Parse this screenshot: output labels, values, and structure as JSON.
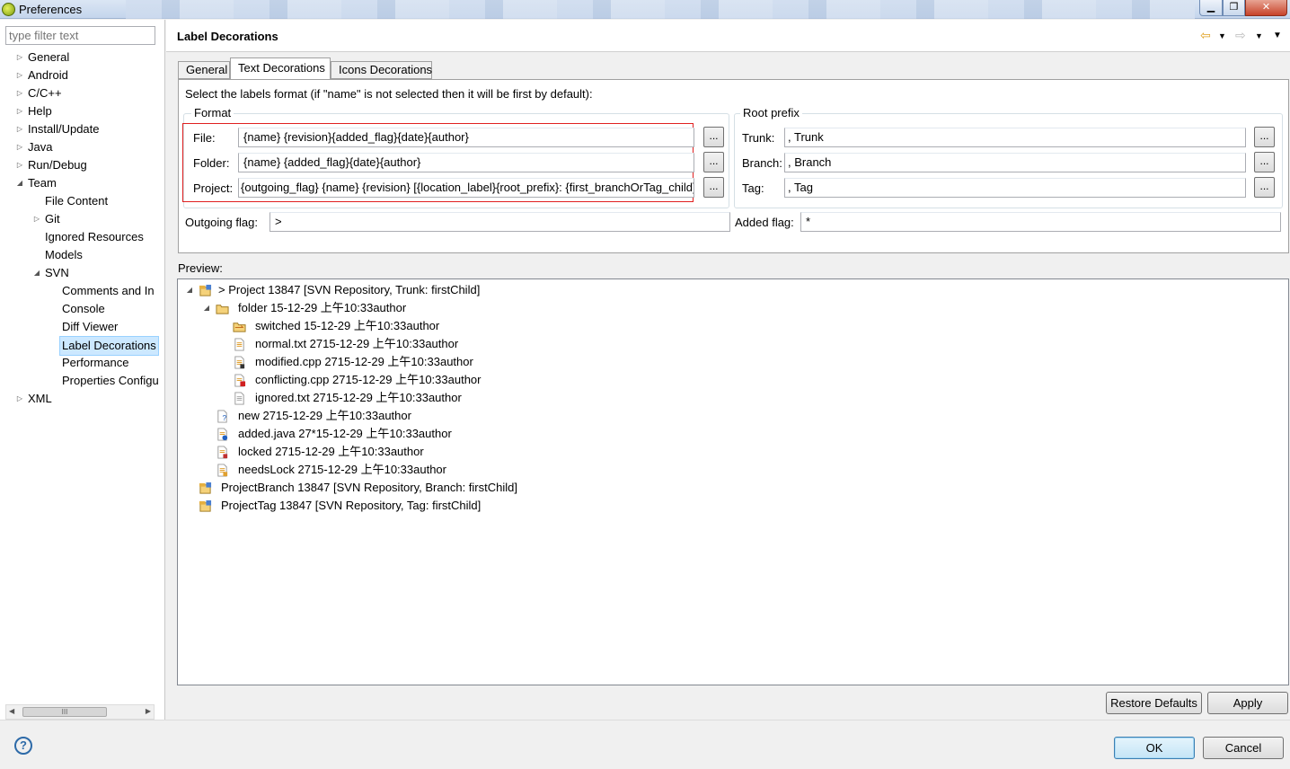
{
  "window": {
    "title": "Preferences"
  },
  "filter": {
    "placeholder": "type filter text"
  },
  "tree": [
    {
      "label": "General",
      "arrow": "▷"
    },
    {
      "label": "Android",
      "arrow": "▷"
    },
    {
      "label": "C/C++",
      "arrow": "▷"
    },
    {
      "label": "Help",
      "arrow": "▷"
    },
    {
      "label": "Install/Update",
      "arrow": "▷"
    },
    {
      "label": "Java",
      "arrow": "▷"
    },
    {
      "label": "Run/Debug",
      "arrow": "▷"
    },
    {
      "label": "Team",
      "arrow": "◢"
    },
    {
      "label": "File Content",
      "arrow": ""
    },
    {
      "label": "Git",
      "arrow": "▷"
    },
    {
      "label": "Ignored Resources",
      "arrow": ""
    },
    {
      "label": "Models",
      "arrow": ""
    },
    {
      "label": "SVN",
      "arrow": "◢"
    },
    {
      "label": "Comments and In",
      "arrow": ""
    },
    {
      "label": "Console",
      "arrow": ""
    },
    {
      "label": "Diff Viewer",
      "arrow": ""
    },
    {
      "label": "Label Decorations",
      "arrow": ""
    },
    {
      "label": "Performance",
      "arrow": ""
    },
    {
      "label": "Properties Configu",
      "arrow": ""
    },
    {
      "label": "XML",
      "arrow": "▷"
    }
  ],
  "scrollbar": {
    "thumb_label": "III"
  },
  "page": {
    "title": "Label Decorations"
  },
  "tabs": [
    "General",
    "Text Decorations",
    "Icons Decorations"
  ],
  "instruction": "Select the labels format (if \"name\" is not selected then it will be first by default):",
  "format": {
    "title": "Format",
    "file_label": "File:",
    "file_value": "{name} {revision}{added_flag}{date}{author}",
    "folder_label": "Folder:",
    "folder_value": "{name} {added_flag}{date}{author}",
    "project_label": "Project:",
    "project_value": "{outgoing_flag} {name} {revision} [{location_label}{root_prefix}: {first_branchOrTag_child}]",
    "browse_label": "..."
  },
  "root_prefix": {
    "title": "Root prefix",
    "trunk_label": "Trunk:",
    "trunk_value": ", Trunk",
    "branch_label": "Branch:",
    "branch_value": ", Branch",
    "tag_label": "Tag:",
    "tag_value": ", Tag"
  },
  "flags": {
    "outgoing_label": "Outgoing flag:",
    "outgoing_value": ">",
    "added_label": "Added flag:",
    "added_value": "*"
  },
  "preview": {
    "label": "Preview:",
    "items": [
      {
        "text": "> Project 13847 [SVN Repository, Trunk: firstChild]",
        "icon": "project-icon"
      },
      {
        "text": "folder 15-12-29 上午10:33author",
        "icon": "folder-icon"
      },
      {
        "text": "switched 15-12-29 上午10:33author",
        "icon": "switched-folder-icon"
      },
      {
        "text": "normal.txt 2715-12-29 上午10:33author",
        "icon": "file-icon"
      },
      {
        "text": "modified.cpp 2715-12-29 上午10:33author",
        "icon": "modified-file-icon"
      },
      {
        "text": "conflicting.cpp 2715-12-29 上午10:33author",
        "icon": "conflict-file-icon"
      },
      {
        "text": "ignored.txt 2715-12-29 上午10:33author",
        "icon": "ignored-file-icon"
      },
      {
        "text": "new 2715-12-29 上午10:33author",
        "icon": "new-file-icon"
      },
      {
        "text": "added.java 27*15-12-29 上午10:33author",
        "icon": "added-file-icon"
      },
      {
        "text": "locked 2715-12-29 上午10:33author",
        "icon": "locked-file-icon"
      },
      {
        "text": "needsLock 2715-12-29 上午10:33author",
        "icon": "needslock-file-icon"
      },
      {
        "text": "ProjectBranch 13847 [SVN Repository, Branch: firstChild]",
        "icon": "project-icon"
      },
      {
        "text": "ProjectTag 13847 [SVN Repository, Tag: firstChild]",
        "icon": "project-icon"
      }
    ]
  },
  "buttons": {
    "restore_defaults": "Restore Defaults",
    "apply": "Apply",
    "ok": "OK",
    "cancel": "Cancel",
    "help": "?"
  },
  "colors": {
    "selection": "#cce8ff",
    "highlight_box": "#e02020"
  }
}
